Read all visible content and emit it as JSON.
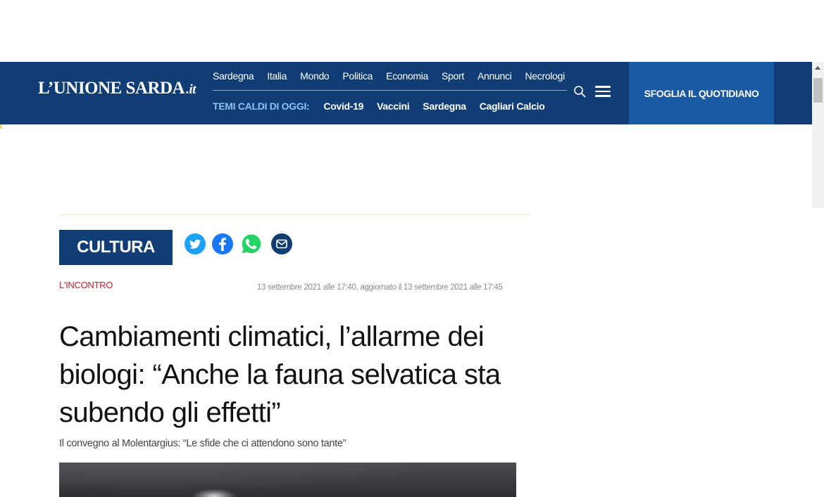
{
  "header": {
    "logo_main": "L’UNIONE SARDA",
    "logo_tld": ".it",
    "nav_items": [
      "Sardegna",
      "Italia",
      "Mondo",
      "Politica",
      "Economia",
      "Sport",
      "Annunci",
      "Necrologi"
    ],
    "hot_topics_label": "TEMI CALDI DI OGGI:",
    "hot_topics": [
      "Covid-19",
      "Vaccini",
      "Sardegna",
      "Cagliari Calcio"
    ],
    "search_icon": "search-icon",
    "menu_icon": "hamburger-menu-icon",
    "newspaper_button": "SFOGLIA IL QUOTIDIANO"
  },
  "colors": {
    "header_bg": "#0f3d74",
    "newspaper_button_bg": "#1a5aa3",
    "kicker": "#c0222c",
    "twitter": "#1da1f2",
    "facebook": "#1877f2",
    "whatsapp": "#25d366",
    "email": "#0f3d74"
  },
  "article": {
    "section": "CULTURA",
    "share_icons": [
      "twitter-icon",
      "facebook-icon",
      "whatsapp-icon",
      "email-icon"
    ],
    "kicker": "L'INCONTRO",
    "dates": "13 settembre 2021 alle 17:40, aggiornato il 13 settembre 2021 alle 17:45",
    "headline": "Cambiamenti climatici, l’allarme dei biologi: “Anche la fauna selvatica sta subendo gli effetti”",
    "subtitle": "Il convegno al Molentargius: “Le sfide che ci attendono sono tante”"
  }
}
